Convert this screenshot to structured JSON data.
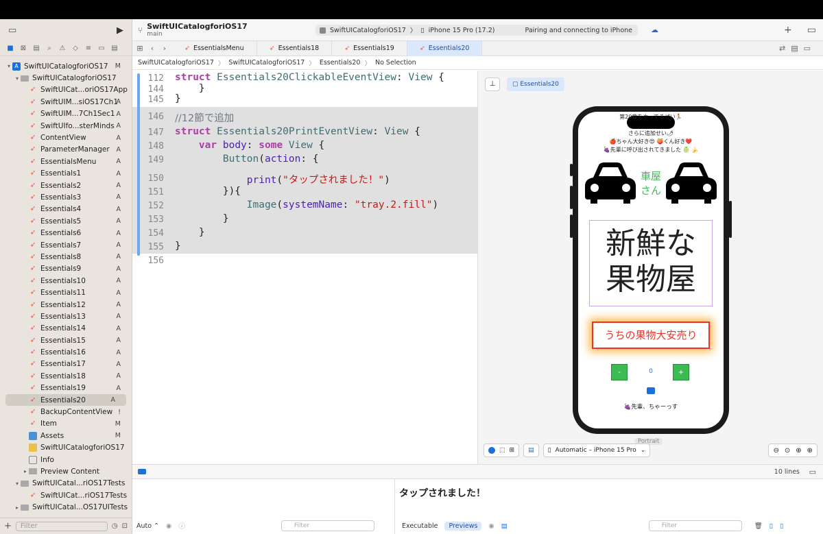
{
  "sidebar": {
    "items": [
      {
        "label": "SwiftUICatalogforiOS17",
        "status": "M",
        "kind": "project",
        "indent": 0,
        "disc": "▾"
      },
      {
        "label": "SwiftUICatalogforiOS17",
        "status": "",
        "kind": "folder",
        "indent": 1,
        "disc": "▾"
      },
      {
        "label": "SwiftUICat...oriOS17App",
        "status": "",
        "kind": "swift",
        "indent": 2,
        "disc": ""
      },
      {
        "label": "SwiftUIM...siOS17Ch1",
        "status": "A",
        "kind": "swift",
        "indent": 2,
        "disc": ""
      },
      {
        "label": "SwiftUIM...7Ch1Sec1",
        "status": "A",
        "kind": "swift",
        "indent": 2,
        "disc": ""
      },
      {
        "label": "SwiftUIfo...sterMinds",
        "status": "A",
        "kind": "swift",
        "indent": 2,
        "disc": ""
      },
      {
        "label": "ContentView",
        "status": "A",
        "kind": "swift",
        "indent": 2,
        "disc": ""
      },
      {
        "label": "ParameterManager",
        "status": "A",
        "kind": "swift",
        "indent": 2,
        "disc": ""
      },
      {
        "label": "EssentialsMenu",
        "status": "A",
        "kind": "swift",
        "indent": 2,
        "disc": ""
      },
      {
        "label": "Essentials1",
        "status": "A",
        "kind": "swift",
        "indent": 2,
        "disc": ""
      },
      {
        "label": "Essentials2",
        "status": "A",
        "kind": "swift",
        "indent": 2,
        "disc": ""
      },
      {
        "label": "Essentials3",
        "status": "A",
        "kind": "swift",
        "indent": 2,
        "disc": ""
      },
      {
        "label": "Essentials4",
        "status": "A",
        "kind": "swift",
        "indent": 2,
        "disc": ""
      },
      {
        "label": "Essentials5",
        "status": "A",
        "kind": "swift",
        "indent": 2,
        "disc": ""
      },
      {
        "label": "Essentials6",
        "status": "A",
        "kind": "swift",
        "indent": 2,
        "disc": ""
      },
      {
        "label": "Essentials7",
        "status": "A",
        "kind": "swift",
        "indent": 2,
        "disc": ""
      },
      {
        "label": "Essentials8",
        "status": "A",
        "kind": "swift",
        "indent": 2,
        "disc": ""
      },
      {
        "label": "Essentials9",
        "status": "A",
        "kind": "swift",
        "indent": 2,
        "disc": ""
      },
      {
        "label": "Essentials10",
        "status": "A",
        "kind": "swift",
        "indent": 2,
        "disc": ""
      },
      {
        "label": "Essentials11",
        "status": "A",
        "kind": "swift",
        "indent": 2,
        "disc": ""
      },
      {
        "label": "Essentials12",
        "status": "A",
        "kind": "swift",
        "indent": 2,
        "disc": ""
      },
      {
        "label": "Essentials13",
        "status": "A",
        "kind": "swift",
        "indent": 2,
        "disc": ""
      },
      {
        "label": "Essentials14",
        "status": "A",
        "kind": "swift",
        "indent": 2,
        "disc": ""
      },
      {
        "label": "Essentials15",
        "status": "A",
        "kind": "swift",
        "indent": 2,
        "disc": ""
      },
      {
        "label": "Essentials16",
        "status": "A",
        "kind": "swift",
        "indent": 2,
        "disc": ""
      },
      {
        "label": "Essentials17",
        "status": "A",
        "kind": "swift",
        "indent": 2,
        "disc": ""
      },
      {
        "label": "Essentials18",
        "status": "A",
        "kind": "swift",
        "indent": 2,
        "disc": ""
      },
      {
        "label": "Essentials19",
        "status": "A",
        "kind": "swift",
        "indent": 2,
        "disc": ""
      },
      {
        "label": "Essentials20",
        "status": "A",
        "kind": "swift",
        "indent": 2,
        "disc": "",
        "selected": true
      },
      {
        "label": "BackupContentView",
        "status": "!",
        "kind": "swift",
        "indent": 2,
        "disc": ""
      },
      {
        "label": "Item",
        "status": "M",
        "kind": "swift",
        "indent": 2,
        "disc": ""
      },
      {
        "label": "Assets",
        "status": "M",
        "kind": "assets",
        "indent": 2,
        "disc": ""
      },
      {
        "label": "SwiftUICatalogforiOS17",
        "status": "",
        "kind": "entitlements",
        "indent": 2,
        "disc": ""
      },
      {
        "label": "Info",
        "status": "",
        "kind": "plist",
        "indent": 2,
        "disc": ""
      },
      {
        "label": "Preview Content",
        "status": "",
        "kind": "folder",
        "indent": 2,
        "disc": "▸"
      },
      {
        "label": "SwiftUICatal...riOS17Tests",
        "status": "",
        "kind": "folder",
        "indent": 1,
        "disc": "▾"
      },
      {
        "label": "SwiftUICat...riOS17Tests",
        "status": "",
        "kind": "swift",
        "indent": 2,
        "disc": ""
      },
      {
        "label": "SwiftUICatal...OS17UITests",
        "status": "",
        "kind": "folder",
        "indent": 1,
        "disc": "▸"
      }
    ],
    "filter_placeholder": "Filter"
  },
  "toolbar": {
    "project": "SwiftUICatalogforiOS17",
    "branch": "main",
    "scheme": "SwiftUICatalogforiOS17",
    "device": "iPhone 15 Pro (17.2)",
    "status": "Pairing and connecting to iPhone"
  },
  "tabs": [
    {
      "label": "EssentialsMenu",
      "active": false
    },
    {
      "label": "Essentials18",
      "active": false
    },
    {
      "label": "Essentials19",
      "active": false
    },
    {
      "label": "Essentials20",
      "active": true
    }
  ],
  "jumpbar": [
    "SwiftUICatalogforiOS17",
    "SwiftUICatalogforiOS17",
    "Essentials20",
    "No Selection"
  ],
  "editor": {
    "lines": [
      {
        "n": "112",
        "t": "struct Essentials20ClickableEventView: View {"
      },
      {
        "n": "144",
        "t": "    }"
      },
      {
        "n": "145",
        "t": "}"
      },
      {
        "n": "146",
        "t": "//12節で追加"
      },
      {
        "n": "147",
        "t": "struct Essentials20PrintEventView: View {"
      },
      {
        "n": "148",
        "t": "    var body: some View {"
      },
      {
        "n": "149",
        "t": "        Button(action: {"
      },
      {
        "n": "150",
        "t": "            print(\"タップされました！\")"
      },
      {
        "n": "151",
        "t": "        }){"
      },
      {
        "n": "152",
        "t": "            Image(systemName: \"tray.2.fill\")"
      },
      {
        "n": "153",
        "t": "        }"
      },
      {
        "n": "154",
        "t": "    }"
      },
      {
        "n": "155",
        "t": "}"
      },
      {
        "n": "156",
        "t": ""
      }
    ]
  },
  "preview": {
    "chip": "Essentials20",
    "screen": {
      "line1": "第20章をやってるぜい🏃",
      "line2": "さらに追加せい🌶",
      "line3": "🍎ちゃん大好き😍 🍑くん好き❤️",
      "line4": "🍇先輩に呼び出されてきました 🍈 🍌",
      "car_label": "車屋\nさん",
      "big_text_1": "新鮮な",
      "big_text_2": "果物屋",
      "sale_button": "うちの果物大安売り",
      "minus": "-",
      "count": "0",
      "plus": "+",
      "footer": "🍇先輩、ちゃーっす"
    },
    "portrait_label": "Portrait",
    "device_picker": "Automatic – iPhone 15 Pro"
  },
  "debug": {
    "line_count": "10 lines",
    "console_output": "タップされました！",
    "auto_label": "Auto ⌃",
    "filter_placeholder": "Filter",
    "executable_label": "Executable",
    "previews_label": "Previews"
  },
  "colors": {
    "accent": "#1d6fd9",
    "swift": "#f05138",
    "keyword": "#ad3da4",
    "type": "#3e6d74",
    "string": "#c41a16",
    "green_button": "#3cba54",
    "sale_red": "#e8352c"
  }
}
